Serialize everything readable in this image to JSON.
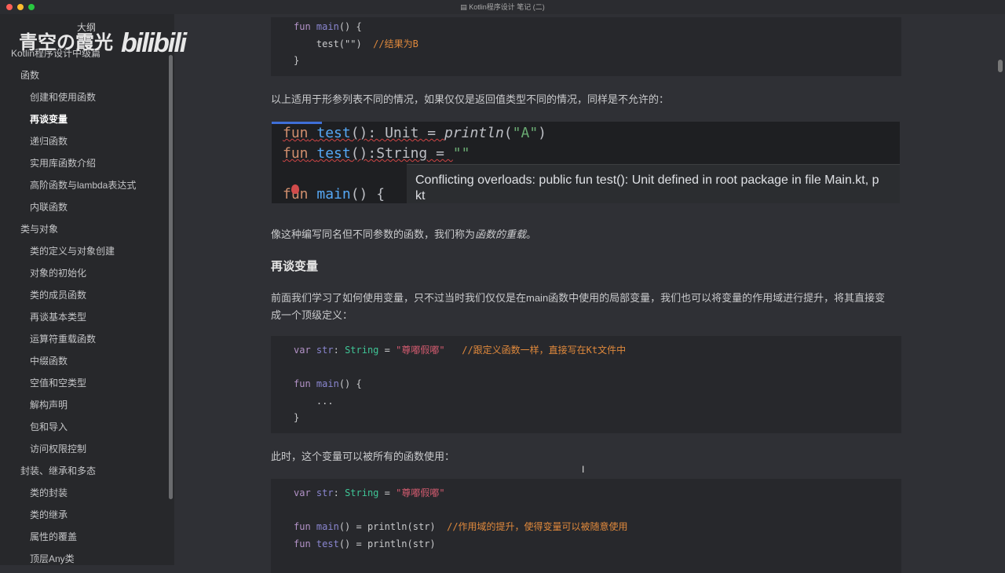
{
  "window": {
    "title": "Kotlin程序设计 笔记 (二)"
  },
  "watermark": {
    "author": "青空の霞光",
    "brand": "bilibili"
  },
  "sidebar": {
    "outline_label": "大纲",
    "items": [
      {
        "label": "Kotlin程序设计中级篇",
        "level": 0
      },
      {
        "label": "函数",
        "level": 1
      },
      {
        "label": "创建和使用函数",
        "level": 2
      },
      {
        "label": "再谈变量",
        "level": 2,
        "active": true
      },
      {
        "label": "递归函数",
        "level": 2
      },
      {
        "label": "实用库函数介绍",
        "level": 2
      },
      {
        "label": "高阶函数与lambda表达式",
        "level": 2
      },
      {
        "label": "内联函数",
        "level": 2
      },
      {
        "label": "类与对象",
        "level": 1
      },
      {
        "label": "类的定义与对象创建",
        "level": 2
      },
      {
        "label": "对象的初始化",
        "level": 2
      },
      {
        "label": "类的成员函数",
        "level": 2
      },
      {
        "label": "再谈基本类型",
        "level": 2
      },
      {
        "label": "运算符重载函数",
        "level": 2
      },
      {
        "label": "中缀函数",
        "level": 2
      },
      {
        "label": "空值和空类型",
        "level": 2
      },
      {
        "label": "解构声明",
        "level": 2
      },
      {
        "label": "包和导入",
        "level": 2
      },
      {
        "label": "访问权限控制",
        "level": 2
      },
      {
        "label": "封装、继承和多态",
        "level": 1
      },
      {
        "label": "类的封装",
        "level": 2
      },
      {
        "label": "类的继承",
        "level": 2
      },
      {
        "label": "属性的覆盖",
        "level": 2
      },
      {
        "label": "顶层Any类",
        "level": 2
      }
    ]
  },
  "content": {
    "code1": {
      "l1_kw": "fun",
      "l1_fn": "main",
      "l1_rest": "() {",
      "l2_code": "    test(\"\")",
      "l2_comment": "  //结果为B",
      "l3": "}"
    },
    "p1": "以上适用于形参列表不同的情况，如果仅仅是返回值类型不同的情况，同样是不允许的：",
    "ide": {
      "line1": [
        "fun",
        "test",
        "(): Unit = ",
        "println",
        "(",
        "\"A\"",
        ")"
      ],
      "line2": [
        "fun",
        "test",
        "():String = ",
        "\"\""
      ],
      "line3": [
        "fun",
        "main",
        "() {"
      ],
      "tooltip_l1": "Conflicting overloads: public fun test(): Unit defined in root package in file Main.kt, p",
      "tooltip_l2": "kt"
    },
    "p2_a": "像这种编写同名但不同参数的函数，我们称为",
    "p2_em": "函数的重载",
    "p2_b": "。",
    "h_var": "再谈变量",
    "p3_l1": "前面我们学习了如何使用变量，只不过当时我们仅仅是在main函数中使用的局部变量，我们也可以将变量的作用域进行提升，将其直接变",
    "p3_l2": "成一个顶级定义：",
    "code2": {
      "var": "var",
      "name": "str",
      "colon": ": ",
      "type": "String",
      "eq": " = ",
      "str": "\"尊嘟假嘟\"",
      "comment": "   //跟定义函数一样，直接写在Kt文件中",
      "fun": "fun",
      "main": "main",
      "rest": "() {",
      "dots": "    ...",
      "close": "}"
    },
    "p4": "此时，这个变量可以被所有的函数使用：",
    "code3": {
      "var": "var",
      "name": "str",
      "colon": ": ",
      "type": "String",
      "eq": " = ",
      "str": "\"尊嘟假嘟\"",
      "fun": "fun",
      "main": "main",
      "test": "test",
      "body": "() = println(str)",
      "comment": "  //作用域的提升，使得变量可以被随意使用"
    }
  }
}
